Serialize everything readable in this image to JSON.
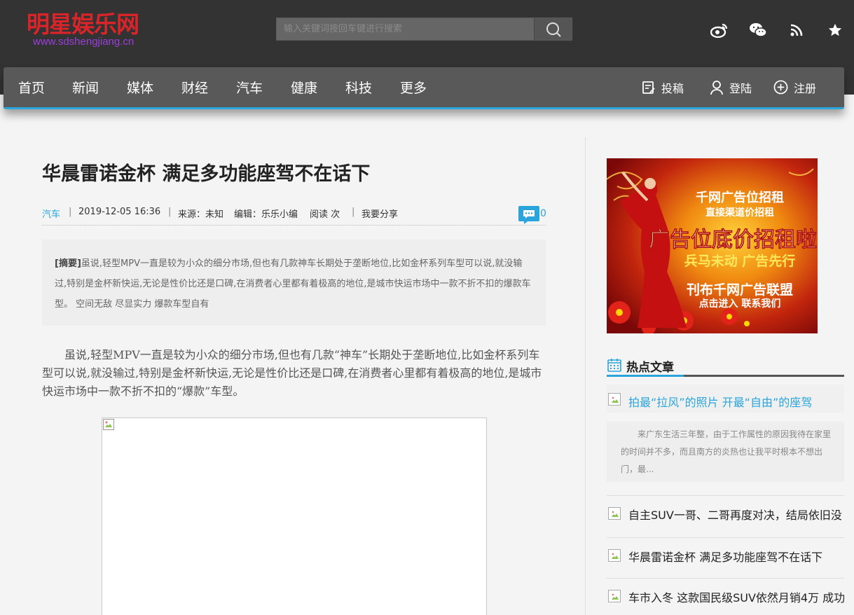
{
  "header": {
    "logo_title": "明星娱乐网",
    "logo_url": "www.sdshengjiang.cn",
    "search_placeholder": "输入关键词按回车键进行搜索",
    "social_icons": [
      "weibo-icon",
      "wechat-icon",
      "rss-icon",
      "star-icon"
    ]
  },
  "nav": {
    "items": [
      "首页",
      "新闻",
      "媒体",
      "财经",
      "汽车",
      "健康",
      "科技",
      "更多"
    ],
    "submit_label": "投稿",
    "login_label": "登陆",
    "register_label": "注册"
  },
  "article": {
    "title": "华晨雷诺金杯 满足多功能座驾不在话下",
    "category": "汽车",
    "date": "2019-12-05 16:36",
    "source": "来源：未知",
    "editor": "编辑：乐乐小编",
    "reads": "阅读  次",
    "share": "我要分享",
    "comment_count": "0",
    "summary_label": "[摘要]",
    "summary_text": "虽说,轻型MPV一直是较为小众的细分市场,但也有几款神车长期处于垄断地位,比如金杯系列车型可以说,就没输过,特别是金杯新快运,无论是性价比还是口碑,在消费者心里都有着极高的地位,是城市快运市场中一款不折不扣的爆款车型。 空间无敌 尽显实力 爆款车型自有",
    "body": "虽说,轻型MPV一直是较为小众的细分市场,但也有几款“神车”长期处于垄断地位,比如金杯系列车型可以说,就没输过,特别是金杯新快运,无论是性价比还是口碑,在消费者心里都有着极高的地位,是城市快运市场中一款不折不扣的“爆款”车型。"
  },
  "ad": {
    "line1": "千网广告位招租",
    "line2": "直接渠道价招租",
    "line3": "广告位底价招租啦",
    "line4": "兵马未动 广告先行",
    "line5": "刊布千网广告联盟",
    "line6": "点击进入 联系我们"
  },
  "sidebar": {
    "hot_title": "热点文章",
    "featured_title": "拍最“拉风”的照片 开最“自由”的座驾",
    "featured_desc": "来广东生活三年整，由于工作属性的原因我待在家里的时间并不多，而且南方的炎热也让我平时根本不想出门，最...",
    "items": [
      "自主SUV一哥、二哥再度对决，结局依旧没",
      "华晨雷诺金杯 满足多功能座驾不在话下",
      "车市入冬 这款国民级SUV依然月销4万 成功"
    ]
  }
}
